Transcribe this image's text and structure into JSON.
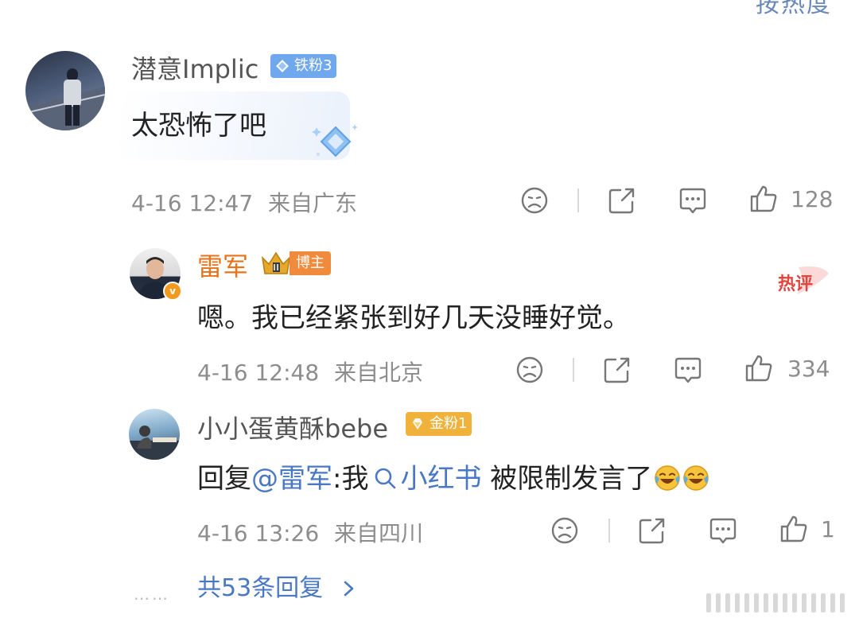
{
  "top_cut_text": "按热度",
  "comment": {
    "username": "潜意Implic",
    "fan_badge": "铁粉3",
    "text": "太恐怖了吧",
    "timestamp": "4-16 12:47",
    "location": "来自广东",
    "likes": "128"
  },
  "replies": [
    {
      "username": "雷军",
      "host_badge": "博主",
      "verified_badge": "v",
      "text": "嗯。我已经紧张到好几天没睡好觉。",
      "timestamp": "4-16 12:48",
      "location": "来自北京",
      "likes": "334",
      "hot_tag": "热评"
    },
    {
      "username": "小小蛋黄酥bebe",
      "fan_badge": "金粉1",
      "text_prefix": "回复",
      "mention": "@雷军",
      "text_middle": ":我",
      "search_link": "小红书",
      "text_suffix": " 被限制发言了",
      "timestamp": "4-16 13:26",
      "location": "来自四川",
      "likes": "1"
    }
  ],
  "more": {
    "dots": "……",
    "label": "共53条回复"
  },
  "icons": {
    "dislike": "frown-face-icon",
    "share": "share-icon",
    "comment": "comment-icon",
    "like": "thumbs-up-icon",
    "emoji": "laughing-crying-emoji-icon"
  },
  "colors": {
    "link": "#4a78c4",
    "host_name": "#e8721b",
    "meta": "#8d8d8d"
  }
}
